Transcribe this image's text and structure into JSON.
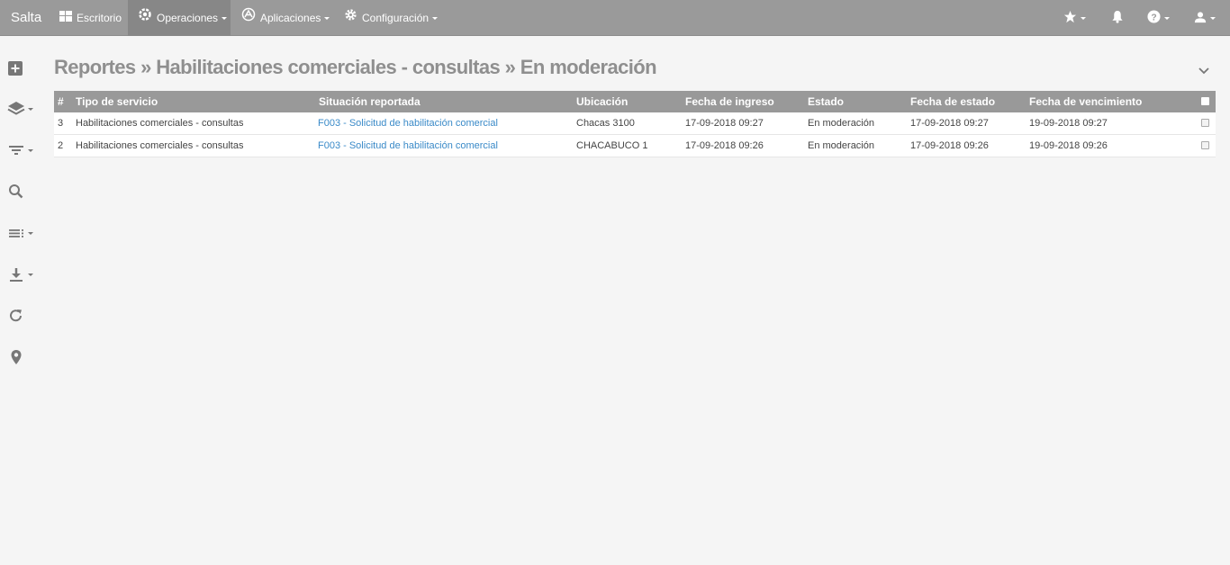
{
  "navbar": {
    "brand": "Salta",
    "items": [
      {
        "label": "Escritorio",
        "icon": "dashboard-icon"
      },
      {
        "label": "Operaciones",
        "icon": "operations-gear-icon",
        "active": true
      },
      {
        "label": "Aplicaciones",
        "icon": "apps-icon"
      },
      {
        "label": "Configuración",
        "icon": "settings-gear-icon"
      }
    ],
    "right_icons": [
      "star-icon",
      "bell-icon",
      "help-icon",
      "user-icon"
    ]
  },
  "sidebar": {
    "items": [
      "add-icon",
      "layers-icon",
      "filter-icon",
      "search-icon",
      "list-icon",
      "download-icon",
      "refresh-icon",
      "location-pin-icon"
    ]
  },
  "page": {
    "title": "Reportes » Habilitaciones comerciales - consultas » En moderación"
  },
  "table": {
    "columns": [
      "#",
      "Tipo de servicio",
      "Situación reportada",
      "Ubicación",
      "Fecha de ingreso",
      "Estado",
      "Fecha de estado",
      "Fecha de vencimiento"
    ],
    "rows": [
      {
        "num": "3",
        "tipo": "Habilitaciones comerciales - consultas",
        "situacion": "F003 - Solicitud de habilitación comercial",
        "ubicacion": "Chacas 3100",
        "ingreso": "17-09-2018 09:27",
        "estado": "En moderación",
        "fecha_estado": "17-09-2018 09:27",
        "vencimiento": "19-09-2018 09:27"
      },
      {
        "num": "2",
        "tipo": "Habilitaciones comerciales - consultas",
        "situacion": "F003 - Solicitud de habilitación comercial",
        "ubicacion": "CHACABUCO 1",
        "ingreso": "17-09-2018 09:26",
        "estado": "En moderación",
        "fecha_estado": "17-09-2018 09:26",
        "vencimiento": "19-09-2018 09:26"
      }
    ]
  },
  "colors": {
    "navbar": "#9a9a9a",
    "navbar_active": "#878787",
    "header": "#999999",
    "link": "#3a8ac8",
    "title": "#8f8f8f"
  }
}
